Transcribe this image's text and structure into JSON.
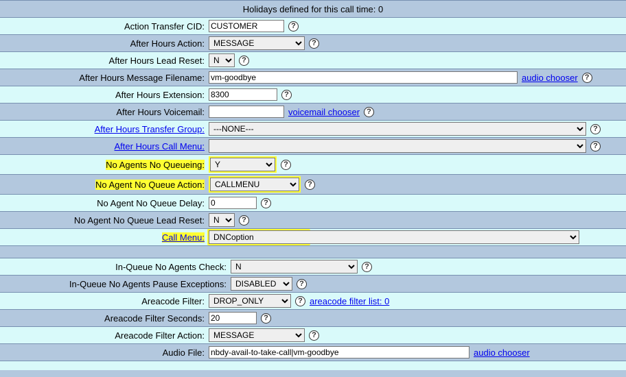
{
  "rows": {
    "holidays_text": "Holidays defined for this call time: 0",
    "action_transfer_cid": {
      "label": "Action Transfer CID:",
      "value": "CUSTOMER"
    },
    "after_hours_action": {
      "label": "After Hours Action:",
      "value": "MESSAGE"
    },
    "after_hours_lead_reset": {
      "label": "After Hours Lead Reset:",
      "value": "N"
    },
    "after_hours_msg_filename": {
      "label": "After Hours Message Filename:",
      "value": "vm-goodbye",
      "link": "audio chooser"
    },
    "after_hours_ext": {
      "label": "After Hours Extension:",
      "value": "8300"
    },
    "after_hours_vm": {
      "label": "After Hours Voicemail:",
      "value": "",
      "link": "voicemail chooser"
    },
    "after_hours_transfer_group": {
      "label": "After Hours Transfer Group:",
      "value": "---NONE---"
    },
    "after_hours_call_menu": {
      "label": "After Hours Call Menu:",
      "value": ""
    },
    "no_agents_no_q": {
      "label": "No Agents No Queueing:",
      "value": "Y"
    },
    "no_agent_no_q_action": {
      "label": "No Agent No Queue Action:",
      "value": "CALLMENU"
    },
    "no_agent_no_q_delay": {
      "label": "No Agent No Queue Delay:",
      "value": "0"
    },
    "no_agent_no_q_lead_reset": {
      "label": "No Agent No Queue Lead Reset:",
      "value": "N"
    },
    "call_menu": {
      "label": "Call Menu:",
      "value": "DNCoption"
    },
    "inqueue_no_agents_check": {
      "label": "In-Queue No Agents Check:",
      "value": "N"
    },
    "inqueue_no_agents_pause_ex": {
      "label": "In-Queue No Agents Pause Exceptions:",
      "value": "DISABLED"
    },
    "areacode_filter": {
      "label": "Areacode Filter:",
      "value": "DROP_ONLY",
      "link": "areacode filter list: 0"
    },
    "areacode_filter_sec": {
      "label": "Areacode Filter Seconds:",
      "value": "20"
    },
    "areacode_filter_action": {
      "label": "Areacode Filter Action:",
      "value": "MESSAGE"
    },
    "audio_file": {
      "label": "Audio File:",
      "value": "nbdy-avail-to-take-call|vm-goodbye",
      "link": "audio chooser"
    }
  }
}
